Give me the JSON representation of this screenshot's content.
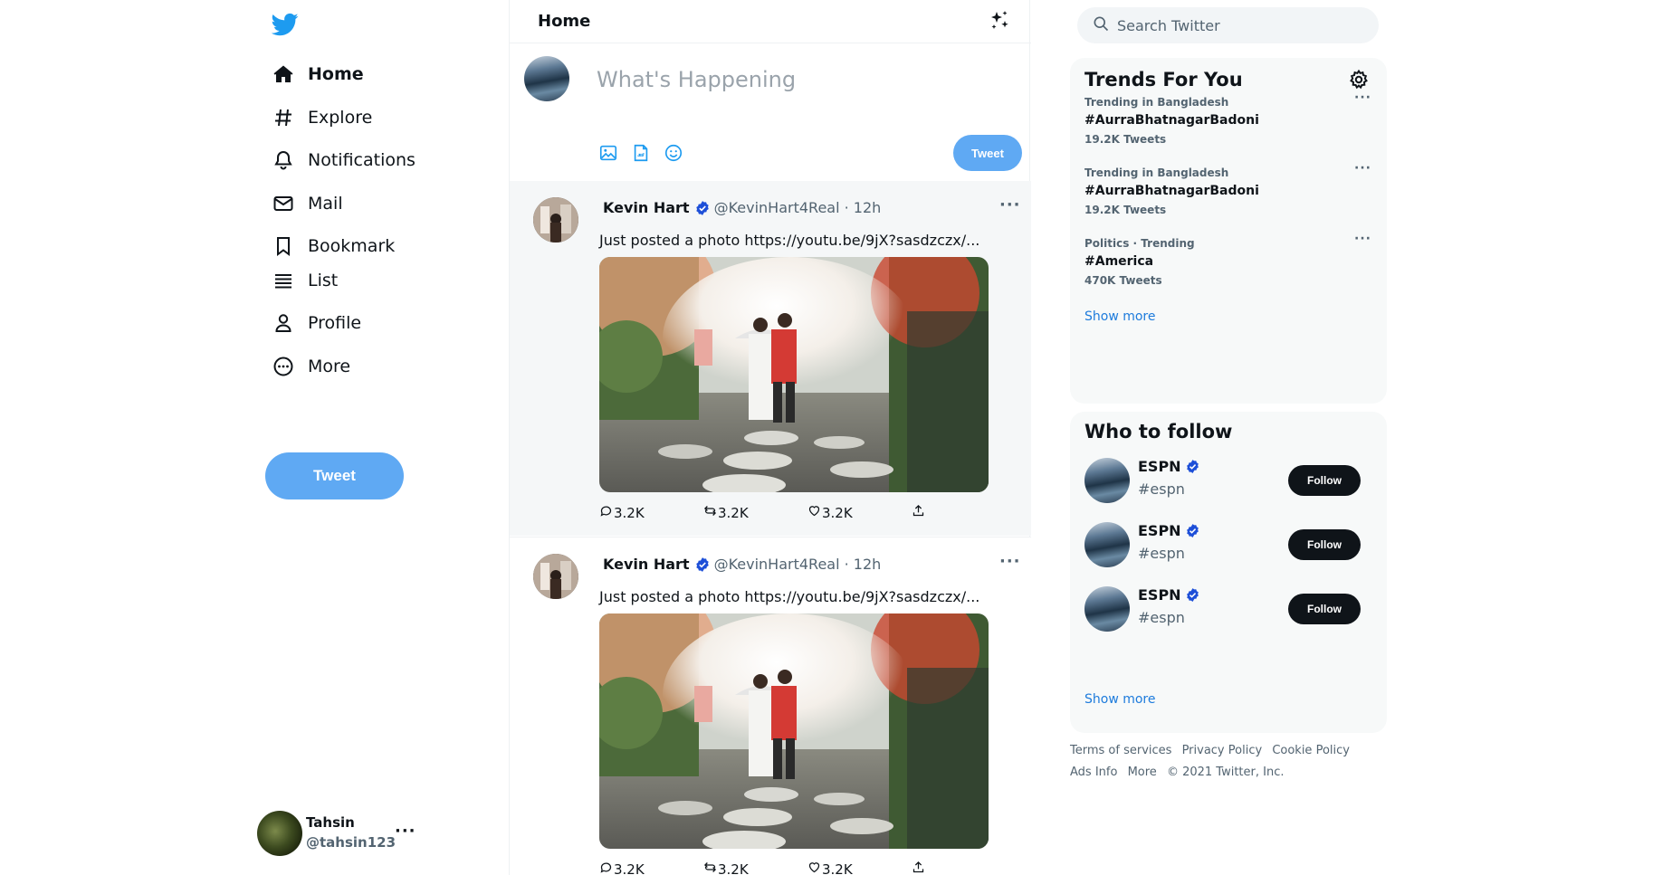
{
  "nav": {
    "items": [
      {
        "label": "Home",
        "icon": "home-icon"
      },
      {
        "label": "Explore",
        "icon": "hashtag-icon"
      },
      {
        "label": "Notifications",
        "icon": "bell-icon"
      },
      {
        "label": "Mail",
        "icon": "mail-icon"
      },
      {
        "label": "Bookmark",
        "icon": "bookmark-icon"
      },
      {
        "label": "List",
        "icon": "list-icon"
      },
      {
        "label": "Profile",
        "icon": "user-icon"
      },
      {
        "label": "More",
        "icon": "more-circle-icon"
      }
    ],
    "tweet_button": "Tweet"
  },
  "account": {
    "name": "Tahsin",
    "handle": "@tahsin123",
    "menu": "···"
  },
  "feed": {
    "title": "Home",
    "compose_placeholder": "What's Happening",
    "compose_button": "Tweet",
    "tweets": [
      {
        "name": "Kevin Hart",
        "handle_time": "@KevinHart4Real · 12h",
        "text": "Just posted a photo https://youtu.be/9jX?sasdzczx/...",
        "replies": "3.2K",
        "retweets": "3.2K",
        "likes": "3.2K"
      },
      {
        "name": "Kevin Hart",
        "handle_time": "@KevinHart4Real · 12h",
        "text": "Just posted a photo https://youtu.be/9jX?sasdzczx/...",
        "replies": "3.2K",
        "retweets": "3.2K",
        "likes": "3.2K"
      }
    ],
    "more": "···"
  },
  "search": {
    "placeholder": "Search Twitter"
  },
  "trends": {
    "title": "Trends For You",
    "items": [
      {
        "context": "Trending in Bangladesh",
        "tag": "#AurraBhatnagarBadoni",
        "count": "19.2K Tweets"
      },
      {
        "context": "Trending in Bangladesh",
        "tag": "#AurraBhatnagarBadoni",
        "count": "19.2K Tweets"
      },
      {
        "context": "Politics · Trending",
        "tag": "#America",
        "count": "470K Tweets"
      }
    ],
    "dots": "···",
    "show_more": "Show more"
  },
  "who_to_follow": {
    "title": "Who to follow",
    "items": [
      {
        "name": "ESPN",
        "handle": "#espn",
        "button": "Follow"
      },
      {
        "name": "ESPN",
        "handle": "#espn",
        "button": "Follow"
      },
      {
        "name": "ESPN",
        "handle": "#espn",
        "button": "Follow"
      }
    ],
    "show_more": "Show more"
  },
  "footer": {
    "links": [
      "Terms of services",
      "Privacy Policy",
      "Cookie Policy",
      "Ads Info",
      "More",
      "© 2021 Twitter, Inc."
    ]
  },
  "colors": {
    "brand": "#1d9bf0",
    "tweet_button": "#5fa9f3",
    "verified": "#1d4fd8",
    "link": "#1d7bdc",
    "follow_button": "#0f1419"
  }
}
